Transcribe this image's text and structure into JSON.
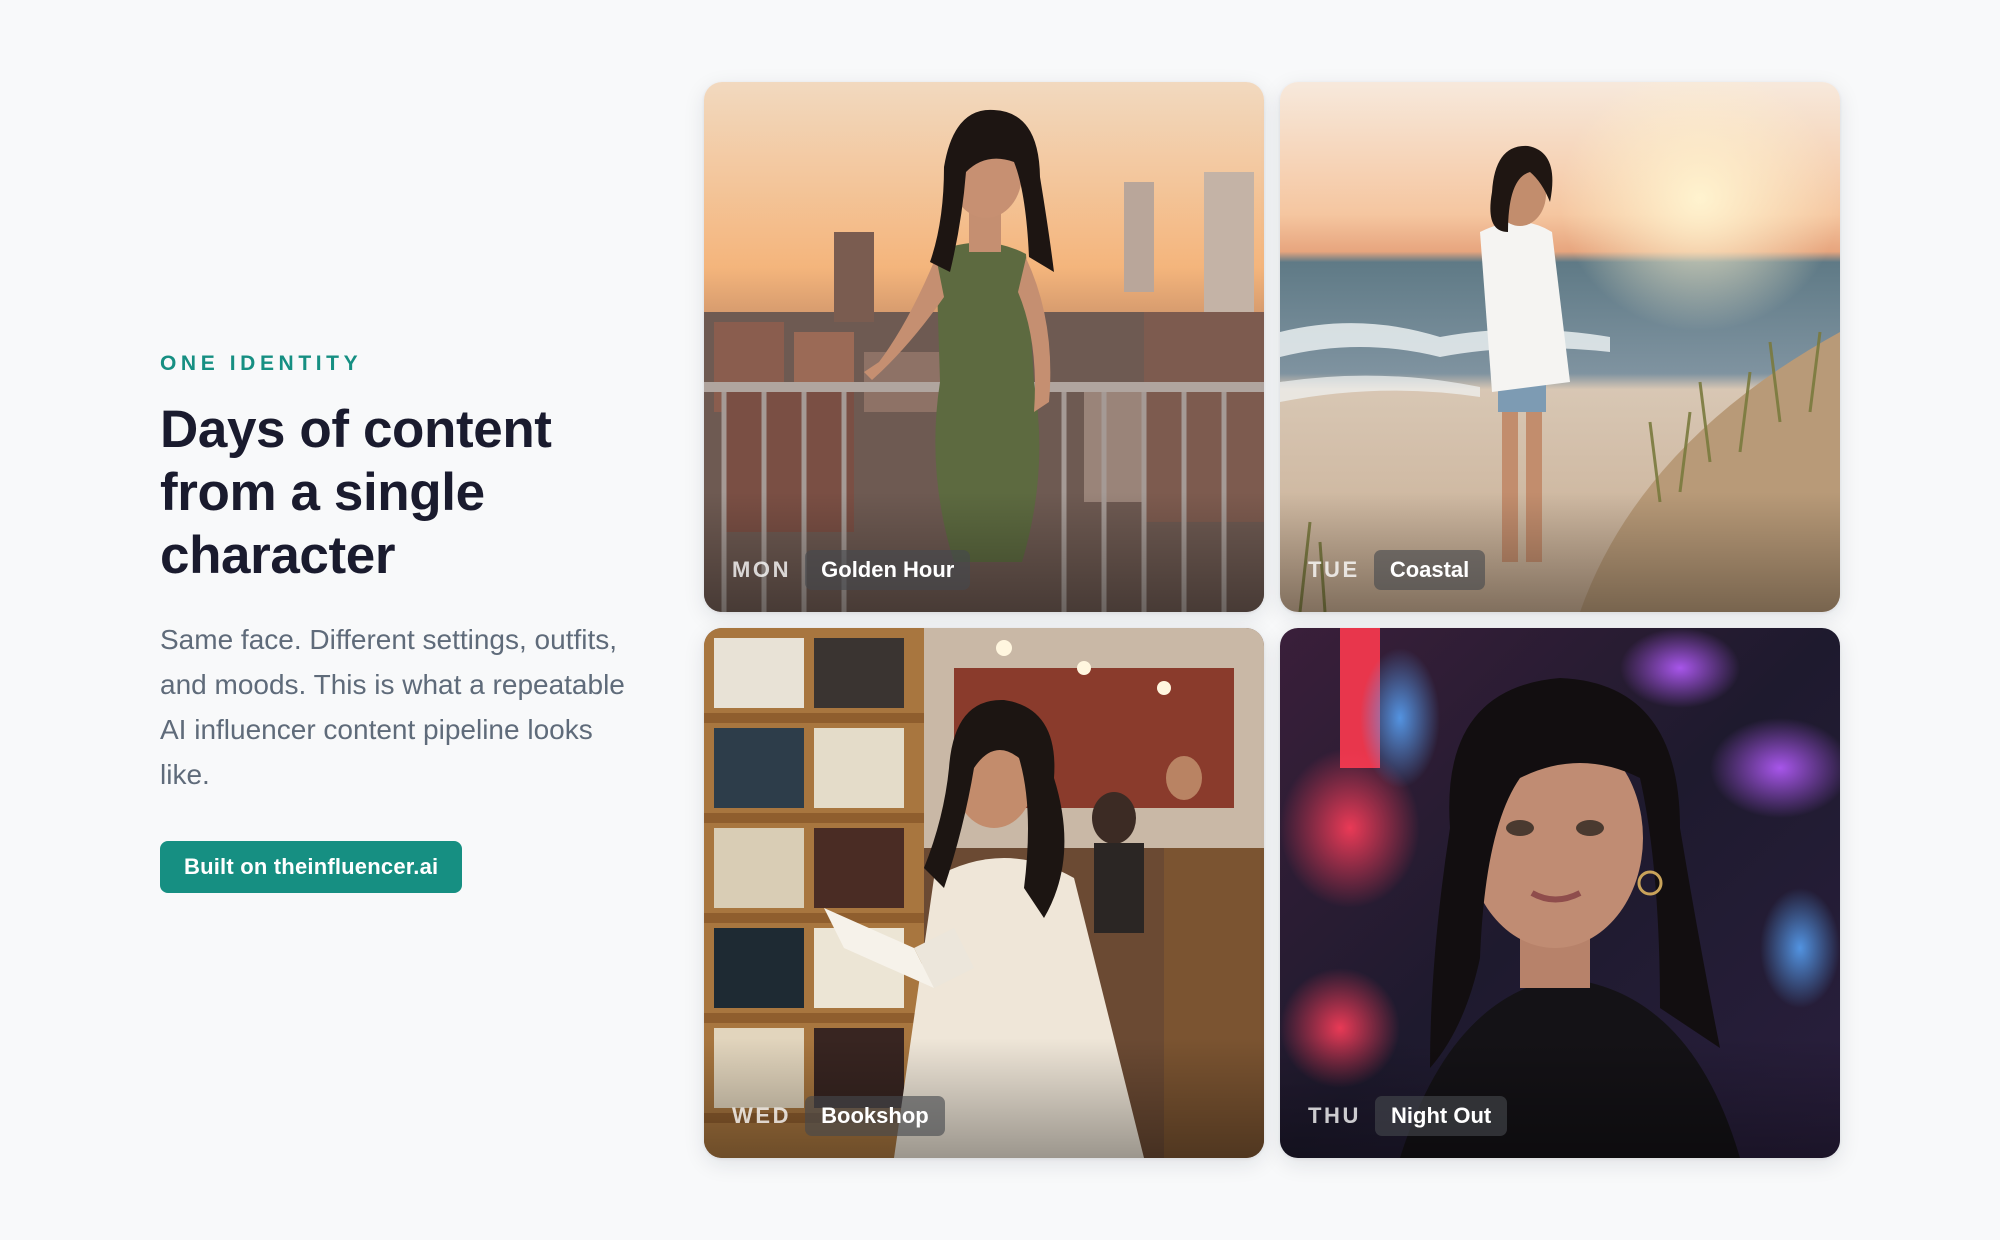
{
  "copy": {
    "eyebrow": "ONE IDENTITY",
    "headline_lines": [
      "Days of content",
      "from a single",
      "character"
    ],
    "lede": "Same face. Different settings, outfits, and moods. This is what a repeatable AI influencer content pipeline looks like.",
    "cta_label": "Built on theinfluencer.ai"
  },
  "cards": [
    {
      "day": "MON",
      "label": "Golden Hour"
    },
    {
      "day": "TUE",
      "label": "Coastal"
    },
    {
      "day": "WED",
      "label": "Bookshop"
    },
    {
      "day": "THU",
      "label": "Night Out"
    }
  ],
  "colors": {
    "accent": "#168f82",
    "heading": "#1a1b2e",
    "body": "#5f6b7a",
    "background": "#f8f9fa"
  }
}
